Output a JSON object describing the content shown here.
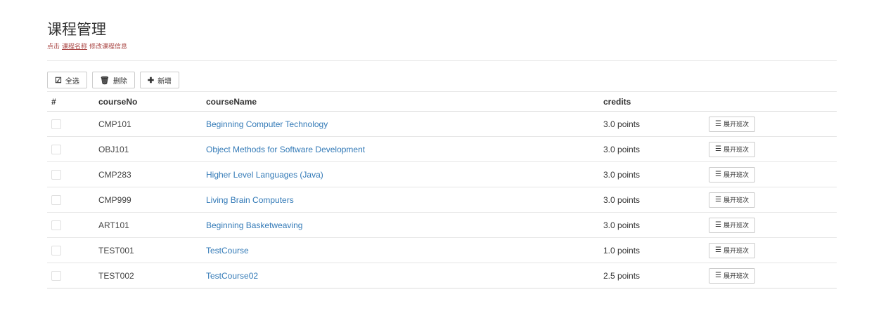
{
  "header": {
    "title": "课程管理",
    "hint_prefix": "点击",
    "hint_link": "课程名称",
    "hint_suffix": "修改课程信息"
  },
  "toolbar": {
    "select_all_label": "全选",
    "select_all_icon": "check-square-icon",
    "delete_label": "删除",
    "delete_icon": "trash-icon",
    "add_label": "新增",
    "add_icon": "plus-icon"
  },
  "table": {
    "columns": [
      "#",
      "courseNo",
      "courseName",
      "credits",
      ""
    ],
    "expand_label": "展开班次",
    "expand_icon": "list-icon",
    "rows": [
      {
        "no": "CMP101",
        "name": "Beginning Computer Technology",
        "credits": "3.0 points"
      },
      {
        "no": "OBJ101",
        "name": "Object Methods for Software Development",
        "credits": "3.0 points"
      },
      {
        "no": "CMP283",
        "name": "Higher Level Languages (Java)",
        "credits": "3.0 points"
      },
      {
        "no": "CMP999",
        "name": "Living Brain Computers",
        "credits": "3.0 points"
      },
      {
        "no": "ART101",
        "name": "Beginning Basketweaving",
        "credits": "3.0 points"
      },
      {
        "no": "TEST001",
        "name": "TestCourse",
        "credits": "1.0 points"
      },
      {
        "no": "TEST002",
        "name": "TestCourse02",
        "credits": "2.5 points"
      }
    ]
  },
  "colors": {
    "link": "#337ab7",
    "hint": "#a94442",
    "border": "#e6e6e6"
  }
}
